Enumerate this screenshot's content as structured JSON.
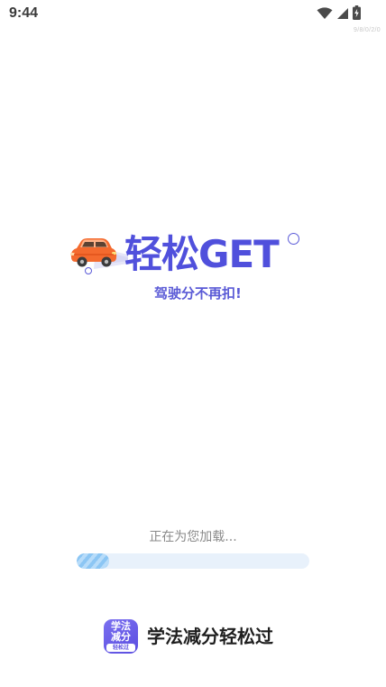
{
  "status_bar": {
    "time": "9:44",
    "icons": [
      "wifi-icon",
      "cellular-signal-icon",
      "battery-charging-icon"
    ]
  },
  "watermark": "9/8/0/2/0",
  "splash": {
    "title": "轻松GET",
    "slogan": "驾驶分不再扣!",
    "illustration": "car-icon"
  },
  "loading": {
    "text": "正在为您加载...",
    "progress": 0.14
  },
  "footer": {
    "app_icon_text": "学法减分",
    "app_icon_tag": "轻松过",
    "app_name": "学法减分轻松过"
  },
  "colors": {
    "brand": "#5050dc",
    "progress_track": "#e8f1fb",
    "progress_fill": "#8cc6f4",
    "car_body": "#f46a2e"
  }
}
